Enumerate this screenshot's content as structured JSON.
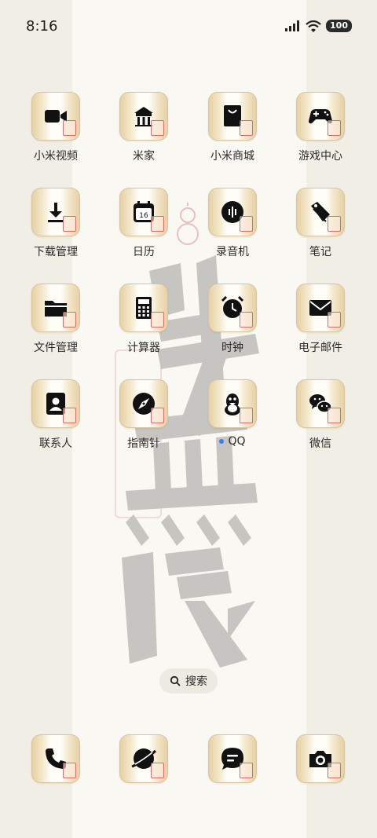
{
  "status_bar": {
    "time": "8:16",
    "battery": "100"
  },
  "apps": [
    {
      "label": "小米视频",
      "icon": "video-camera-icon"
    },
    {
      "label": "米家",
      "icon": "mijia-icon"
    },
    {
      "label": "小米商城",
      "icon": "shopping-bag-icon"
    },
    {
      "label": "游戏中心",
      "icon": "gamepad-icon"
    },
    {
      "label": "下载管理",
      "icon": "download-icon"
    },
    {
      "label": "日历",
      "icon": "calendar-icon",
      "badge": "16"
    },
    {
      "label": "录音机",
      "icon": "recorder-icon"
    },
    {
      "label": "笔记",
      "icon": "tag-icon"
    },
    {
      "label": "文件管理",
      "icon": "folder-icon"
    },
    {
      "label": "计算器",
      "icon": "calculator-icon"
    },
    {
      "label": "时钟",
      "icon": "alarm-clock-icon"
    },
    {
      "label": "电子邮件",
      "icon": "mail-icon"
    },
    {
      "label": "联系人",
      "icon": "contact-icon"
    },
    {
      "label": "指南针",
      "icon": "compass-icon"
    },
    {
      "label": "QQ",
      "icon": "qq-penguin-icon",
      "new_dot": true
    },
    {
      "label": "微信",
      "icon": "wechat-icon"
    }
  ],
  "search": {
    "label": "搜索"
  },
  "dock": [
    {
      "icon": "phone-icon"
    },
    {
      "icon": "browser-icon"
    },
    {
      "icon": "messages-icon"
    },
    {
      "icon": "camera-icon"
    }
  ],
  "colors": {
    "background": "#f1eee6",
    "tile_gold": "#e6d1a6",
    "seal_red": "#c44646",
    "icon_black": "#111111",
    "new_dot": "#3d7ff0"
  }
}
